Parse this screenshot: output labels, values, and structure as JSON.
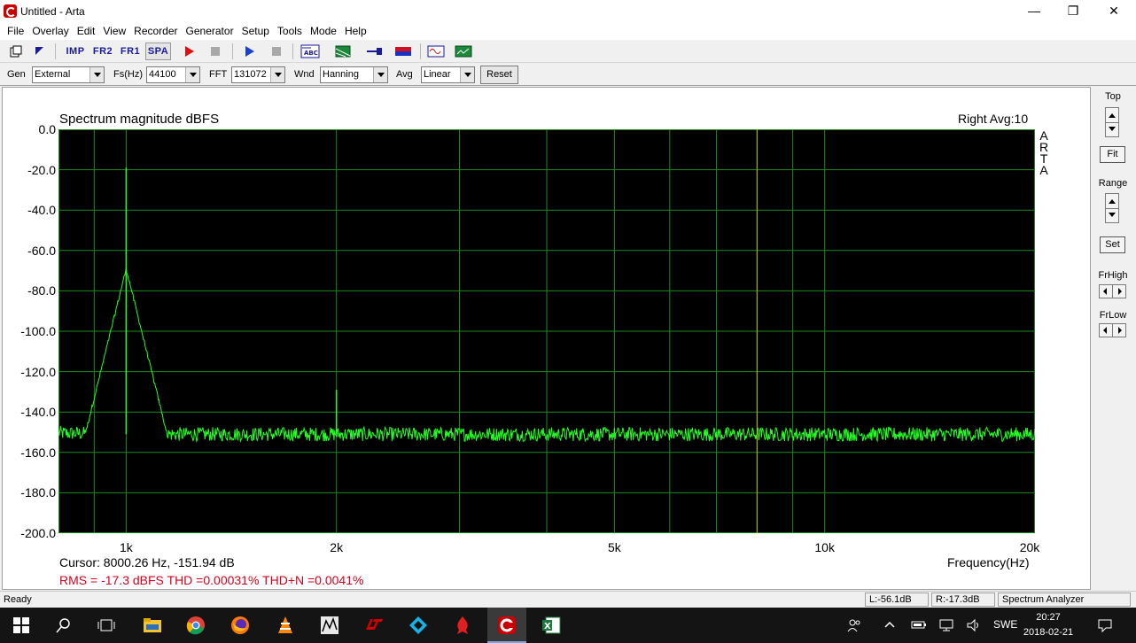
{
  "window": {
    "title": "Untitled - Arta",
    "minimize": "—",
    "maximize": "❐",
    "close": "✕"
  },
  "menu": [
    "File",
    "Overlay",
    "Edit",
    "View",
    "Recorder",
    "Generator",
    "Setup",
    "Tools",
    "Mode",
    "Help"
  ],
  "toolbar": {
    "imp": "IMP",
    "fr2": "FR2",
    "fr1": "FR1",
    "spa": "SPA"
  },
  "controls": {
    "gen_label": "Gen",
    "gen_value": "External",
    "fs_label": "Fs(Hz)",
    "fs_value": "44100",
    "fft_label": "FFT",
    "fft_value": "131072",
    "wnd_label": "Wnd",
    "wnd_value": "Hanning",
    "avg_label": "Avg",
    "avg_value": "Linear",
    "reset": "Reset"
  },
  "plot": {
    "title": "Spectrum magnitude dBFS",
    "channel_avg": "Right  Avg:10",
    "arta": [
      "A",
      "R",
      "T",
      "A"
    ],
    "cursor": "Cursor: 8000.26 Hz, -151.94 dB",
    "stats": "RMS =  -17.3 dBFS   THD =0.00031%   THD+N =0.0041%",
    "xaxis_title": "Frequency(Hz)"
  },
  "chart_data": {
    "type": "line",
    "title": "Spectrum magnitude dBFS",
    "xlabel": "Frequency(Hz)",
    "ylabel": "",
    "x_scale": "log",
    "xlim": [
      800,
      20000
    ],
    "ylim": [
      -200,
      0
    ],
    "y_ticks": [
      "0.0",
      "-20.0",
      "-40.0",
      "-60.0",
      "-80.0",
      "-100.0",
      "-120.0",
      "-140.0",
      "-160.0",
      "-180.0",
      "-200.0"
    ],
    "y_tick_values": [
      0,
      -20,
      -40,
      -60,
      -80,
      -100,
      -120,
      -140,
      -160,
      -180,
      -200
    ],
    "x_tick_labels": [
      "1k",
      "2k",
      "5k",
      "10k",
      "20k"
    ],
    "x_tick_values": [
      1000,
      2000,
      5000,
      10000,
      20000
    ],
    "grid": true,
    "cursor_x": 8000.26,
    "noise_floor_db": -151,
    "peaks": [
      {
        "x": 1000,
        "y": -19
      },
      {
        "x": 2000,
        "y": -129
      }
    ],
    "colors": {
      "background": "#000000",
      "grid": "#1f8a1f",
      "trace": "#22ff22",
      "cursor": "#c8b400"
    }
  },
  "right_panel": {
    "top": "Top",
    "fit": "Fit",
    "range": "Range",
    "set": "Set",
    "frhigh": "FrHigh",
    "frlow": "FrLow"
  },
  "status": {
    "ready": "Ready",
    "left_level": "L:-56.1dB",
    "right_level": "R:-17.3dB",
    "mode": "Spectrum Analyzer"
  },
  "taskbar": {
    "lang": "SWE",
    "time": "20:27",
    "date": "2018-02-21"
  }
}
